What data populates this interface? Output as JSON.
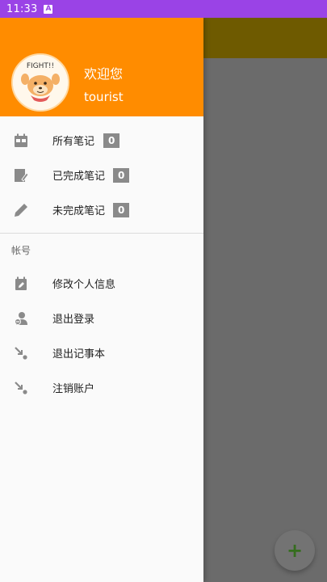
{
  "status_bar": {
    "time": "11:33",
    "notification_icon": "A"
  },
  "drawer": {
    "header": {
      "welcome": "欢迎您",
      "username": "tourist",
      "avatar_text": "FIGHT!!",
      "background_color": "#ff8c00"
    },
    "notes": [
      {
        "label": "所有笔记",
        "count": "0",
        "icon": "calendar-icon"
      },
      {
        "label": "已完成笔记",
        "count": "0",
        "icon": "edit-note-icon"
      },
      {
        "label": "未完成笔记",
        "count": "0",
        "icon": "pencil-icon"
      }
    ],
    "account": {
      "title": "帐号",
      "items": [
        {
          "label": "修改个人信息",
          "icon": "edit-calendar-icon"
        },
        {
          "label": "退出登录",
          "icon": "account-remove-icon"
        },
        {
          "label": "退出记事本",
          "icon": "exit-arrow-icon"
        },
        {
          "label": "注销账户",
          "icon": "cancel-account-icon"
        }
      ]
    }
  },
  "fab": {
    "label": "+"
  }
}
